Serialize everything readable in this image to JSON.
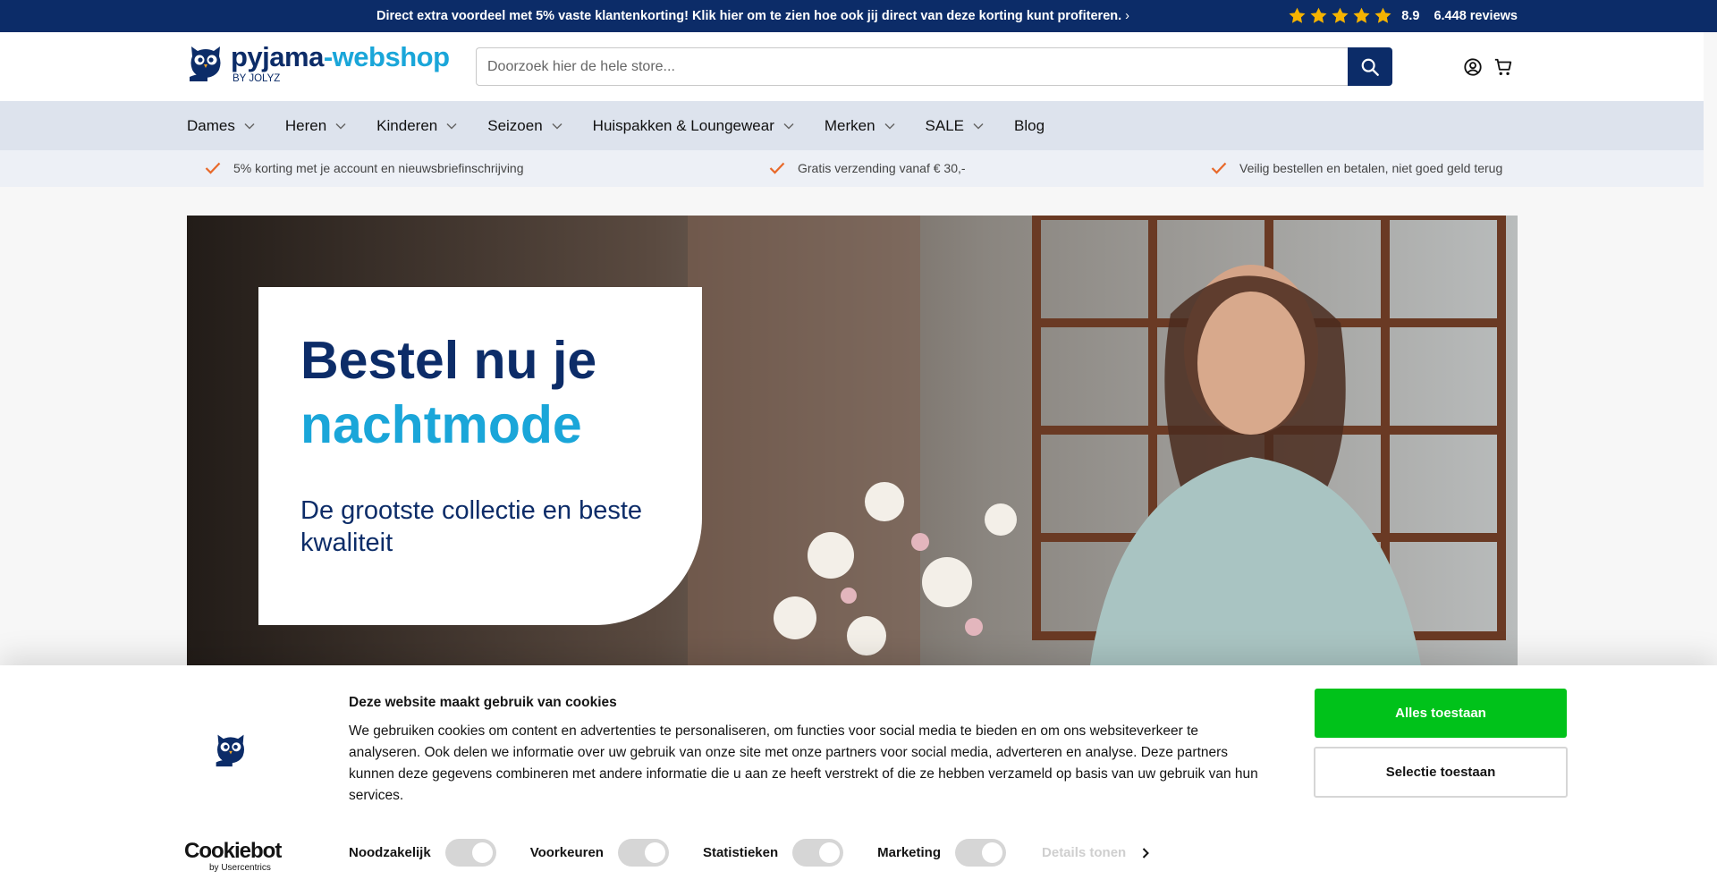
{
  "topbar": {
    "promo": "Direct extra voordeel met 5% vaste klantenkorting! Klik hier om te zien hoe ook jij direct van deze korting kunt profiteren.",
    "stars": 5,
    "score": "8.9",
    "reviews": "6.448 reviews",
    "star_color": "#f5b301"
  },
  "header": {
    "brand_main": "pyjama",
    "brand_dash": "-",
    "brand_shop": "webshop",
    "brand_by": "BY JOLYZ",
    "search_placeholder": "Doorzoek hier de hele store...",
    "icons": [
      "account-icon",
      "cart-icon"
    ]
  },
  "nav": {
    "items": [
      {
        "label": "Dames",
        "dropdown": true
      },
      {
        "label": "Heren",
        "dropdown": true
      },
      {
        "label": "Kinderen",
        "dropdown": true
      },
      {
        "label": "Seizoen",
        "dropdown": true
      },
      {
        "label": "Huispakken & Loungewear",
        "dropdown": true
      },
      {
        "label": "Merken",
        "dropdown": true
      },
      {
        "label": "SALE",
        "dropdown": true
      },
      {
        "label": "Blog",
        "dropdown": false
      }
    ]
  },
  "usps": [
    "5% korting met je account en nieuwsbriefinschrijving",
    "Gratis verzending vanaf € 30,-",
    "Veilig bestellen en betalen, niet goed geld terug"
  ],
  "hero": {
    "title_line1": "Bestel nu je",
    "title_line2": "nachtmode",
    "subtitle": "De grootste collectie en beste kwaliteit"
  },
  "cookie": {
    "title": "Deze website maakt gebruik van cookies",
    "text": "We gebruiken cookies om content en advertenties te personaliseren, om functies voor social media te bieden en om ons websiteverkeer te analyseren. Ook delen we informatie over uw gebruik van onze site met onze partners voor social media, adverteren en analyse. Deze partners kunnen deze gegevens combineren met andere informatie die u aan ze heeft verstrekt of die ze hebben verzameld op basis van uw gebruik van hun services.",
    "allow_all": "Alles toestaan",
    "allow_selection": "Selectie toestaan",
    "toggles": [
      "Noodzakelijk",
      "Voorkeuren",
      "Statistieken",
      "Marketing"
    ],
    "details": "Details tonen",
    "cookiebot_brand": "Cookiebot",
    "cookiebot_by": "by Usercentrics",
    "allow_color": "#00c21a"
  },
  "colors": {
    "navy": "#0c2c68",
    "cyan": "#1aa6d9",
    "check": "#e8692a"
  }
}
